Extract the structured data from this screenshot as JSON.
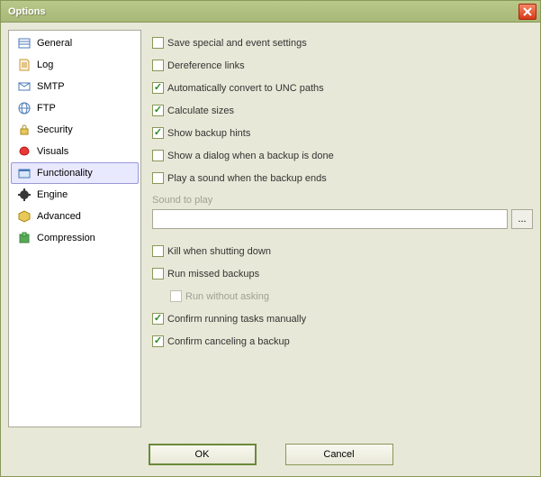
{
  "window": {
    "title": "Options"
  },
  "sidebar": {
    "items": [
      {
        "label": "General",
        "selected": false
      },
      {
        "label": "Log",
        "selected": false
      },
      {
        "label": "SMTP",
        "selected": false
      },
      {
        "label": "FTP",
        "selected": false
      },
      {
        "label": "Security",
        "selected": false
      },
      {
        "label": "Visuals",
        "selected": false
      },
      {
        "label": "Functionality",
        "selected": true
      },
      {
        "label": "Engine",
        "selected": false
      },
      {
        "label": "Advanced",
        "selected": false
      },
      {
        "label": "Compression",
        "selected": false
      }
    ]
  },
  "options": {
    "save_special": {
      "label": "Save special and event settings",
      "checked": false
    },
    "dereference": {
      "label": "Dereference links",
      "checked": false
    },
    "unc": {
      "label": "Automatically convert to UNC paths",
      "checked": true
    },
    "calc_sizes": {
      "label": "Calculate sizes",
      "checked": true
    },
    "hints": {
      "label": "Show backup hints",
      "checked": true
    },
    "dialog_done": {
      "label": "Show a dialog when a backup is done",
      "checked": false
    },
    "play_sound": {
      "label": "Play a sound when the backup ends",
      "checked": false
    },
    "sound_label": "Sound to play",
    "sound_value": "",
    "browse_label": "...",
    "kill": {
      "label": "Kill when shutting down",
      "checked": false
    },
    "run_missed": {
      "label": "Run missed backups",
      "checked": false
    },
    "run_without_asking": {
      "label": "Run without asking",
      "checked": false,
      "disabled": true
    },
    "confirm_running": {
      "label": "Confirm running tasks manually",
      "checked": true
    },
    "confirm_cancel": {
      "label": "Confirm canceling a backup",
      "checked": true
    }
  },
  "buttons": {
    "ok": "OK",
    "cancel": "Cancel"
  }
}
